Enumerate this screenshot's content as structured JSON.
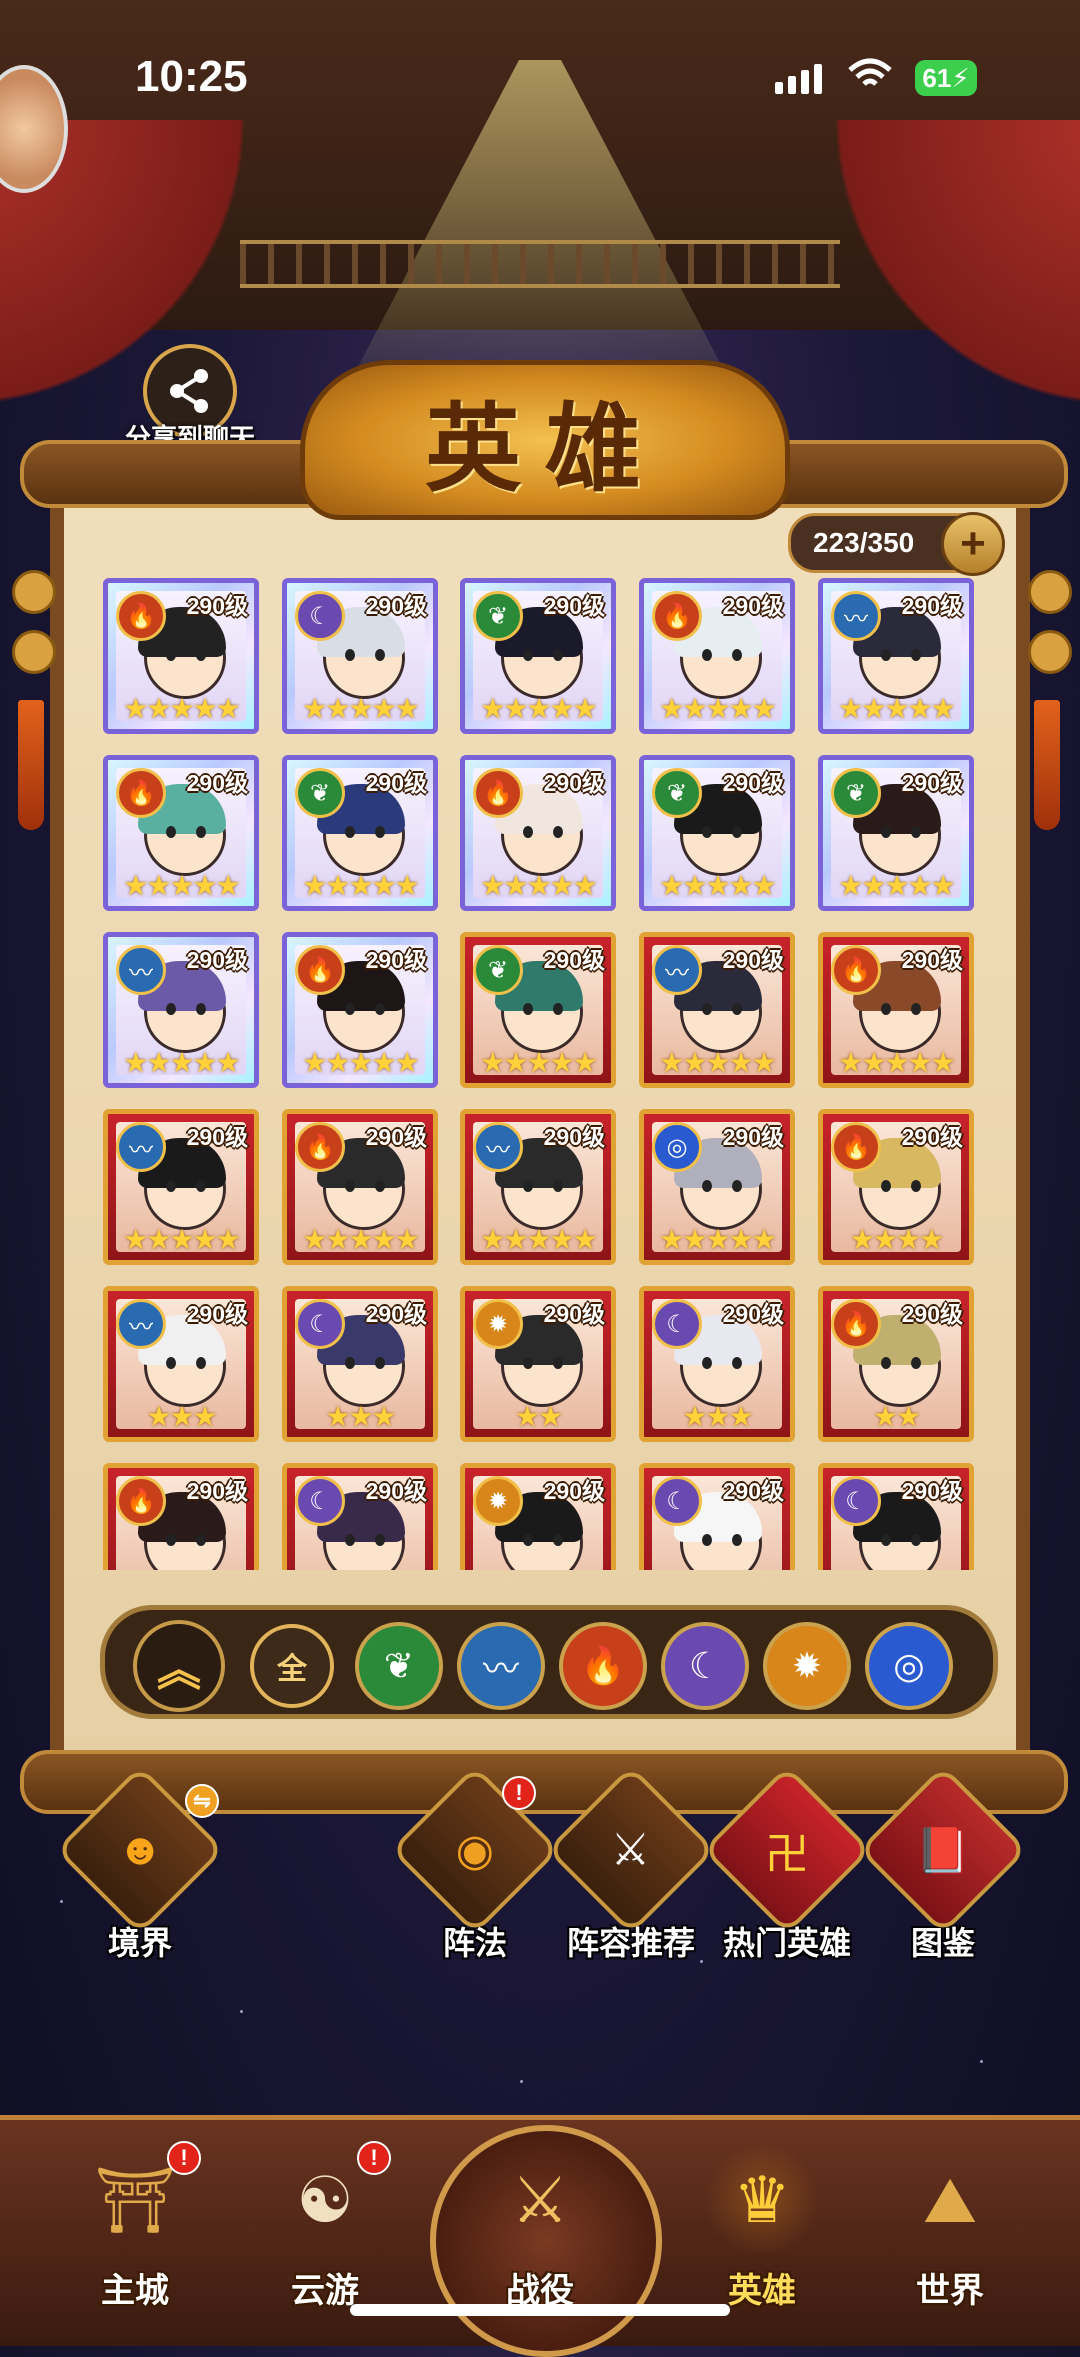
{
  "status_bar": {
    "time": "10:25",
    "battery": "61"
  },
  "share": {
    "label": "分享到聊天"
  },
  "panel": {
    "title": "英雄",
    "count": "223/350",
    "plus": "+"
  },
  "heroes": [
    {
      "level": "290级",
      "frame": "purple",
      "element": "fire",
      "stars": "★★★★★",
      "hair": "#222"
    },
    {
      "level": "290级",
      "frame": "purple",
      "element": "moon",
      "stars": "★★★★★",
      "hair": "#d8dde6"
    },
    {
      "level": "290级",
      "frame": "purple",
      "element": "wood",
      "stars": "★★★★★",
      "hair": "#1a1a2a"
    },
    {
      "level": "290级",
      "frame": "purple",
      "element": "fire",
      "stars": "★★★★★",
      "hair": "#e6eef2"
    },
    {
      "level": "290级",
      "frame": "purple",
      "element": "water",
      "stars": "★★★★★",
      "hair": "#2a2a3a"
    },
    {
      "level": "290级",
      "frame": "purple",
      "element": "fire",
      "stars": "★★★★★",
      "hair": "#5ab0a0"
    },
    {
      "level": "290级",
      "frame": "purple",
      "element": "wood",
      "stars": "★★★★★",
      "hair": "#2a3a7a"
    },
    {
      "level": "290级",
      "frame": "purple",
      "element": "fire",
      "stars": "★★★★★",
      "hair": "#f1e6df"
    },
    {
      "level": "290级",
      "frame": "purple",
      "element": "wood",
      "stars": "★★★★★",
      "hair": "#1a1a1a"
    },
    {
      "level": "290级",
      "frame": "purple",
      "element": "wood",
      "stars": "★★★★★",
      "hair": "#2a1a1a"
    },
    {
      "level": "290级",
      "frame": "purple",
      "element": "water",
      "stars": "★★★★★",
      "hair": "#6a5aa8"
    },
    {
      "level": "290级",
      "frame": "purple",
      "element": "fire",
      "stars": "★★★★★",
      "hair": "#1e1616"
    },
    {
      "level": "290级",
      "frame": "red",
      "element": "wood",
      "stars": "★★★★★",
      "hair": "#2f7a6a"
    },
    {
      "level": "290级",
      "frame": "red",
      "element": "water",
      "stars": "★★★★★",
      "hair": "#2a2a3a"
    },
    {
      "level": "290级",
      "frame": "red",
      "element": "fire",
      "stars": "★★★★★",
      "hair": "#8a4a2a"
    },
    {
      "level": "290级",
      "frame": "red",
      "element": "water",
      "stars": "★★★★★",
      "hair": "#1a1a1a"
    },
    {
      "level": "290级",
      "frame": "red",
      "element": "fire",
      "stars": "★★★★★",
      "hair": "#2a2a2a"
    },
    {
      "level": "290级",
      "frame": "red",
      "element": "water",
      "stars": "★★★★★",
      "hair": "#2a2a2a"
    },
    {
      "level": "290级",
      "frame": "red",
      "element": "vortex",
      "stars": "★★★★★",
      "hair": "#b0b0bc"
    },
    {
      "level": "290级",
      "frame": "red",
      "element": "fire",
      "stars": "★★★★",
      "hair": "#d8b860"
    },
    {
      "level": "290级",
      "frame": "red",
      "element": "water",
      "stars": "★★★",
      "hair": "#f0f0f0"
    },
    {
      "level": "290级",
      "frame": "red",
      "element": "moon",
      "stars": "★★★",
      "hair": "#3a3a6a"
    },
    {
      "level": "290级",
      "frame": "red",
      "element": "sun",
      "stars": "★★",
      "hair": "#2a2a2a"
    },
    {
      "level": "290级",
      "frame": "red",
      "element": "moon",
      "stars": "★★★",
      "hair": "#e8e8f0"
    },
    {
      "level": "290级",
      "frame": "red",
      "element": "fire",
      "stars": "★★",
      "hair": "#c0b070"
    },
    {
      "level": "290级",
      "frame": "red",
      "element": "fire",
      "stars": "",
      "hair": "#2a1a1a"
    },
    {
      "level": "290级",
      "frame": "red",
      "element": "moon",
      "stars": "",
      "hair": "#3a2a4a"
    },
    {
      "level": "290级",
      "frame": "red",
      "element": "sun",
      "stars": "",
      "hair": "#1a1a1a"
    },
    {
      "level": "290级",
      "frame": "red",
      "element": "moon",
      "stars": "",
      "hair": "#f6f6f6"
    },
    {
      "level": "290级",
      "frame": "red",
      "element": "moon",
      "stars": "",
      "hair": "#1a1a1a"
    }
  ],
  "element_icons": {
    "fire": "🔥",
    "water": "〰",
    "wood": "❦",
    "moon": "☾",
    "sun": "✹",
    "vortex": "◎"
  },
  "element_colors": {
    "fire": "#c8401a",
    "water": "#2a6ab0",
    "wood": "#2a8a3a",
    "moon": "#6a4ab0",
    "sun": "#d8861a",
    "vortex": "#2a5ad0"
  },
  "filter_bar": {
    "sort_icon": "︽",
    "all_label": "全",
    "elements": [
      "wood",
      "water",
      "fire",
      "moon",
      "sun",
      "vortex"
    ]
  },
  "functions": [
    {
      "label": "境界",
      "icon": "face-icon"
    },
    {
      "label": "阵法",
      "icon": "vortex-icon"
    },
    {
      "label": "阵容推荐",
      "icon": "warriors-icon"
    },
    {
      "label": "热门英雄",
      "icon": "seal-icon"
    },
    {
      "label": "图鉴",
      "icon": "book-icon"
    }
  ],
  "nav": [
    {
      "label": "主城"
    },
    {
      "label": "云游"
    },
    {
      "label": "战役"
    },
    {
      "label": "英雄"
    },
    {
      "label": "世界"
    }
  ]
}
